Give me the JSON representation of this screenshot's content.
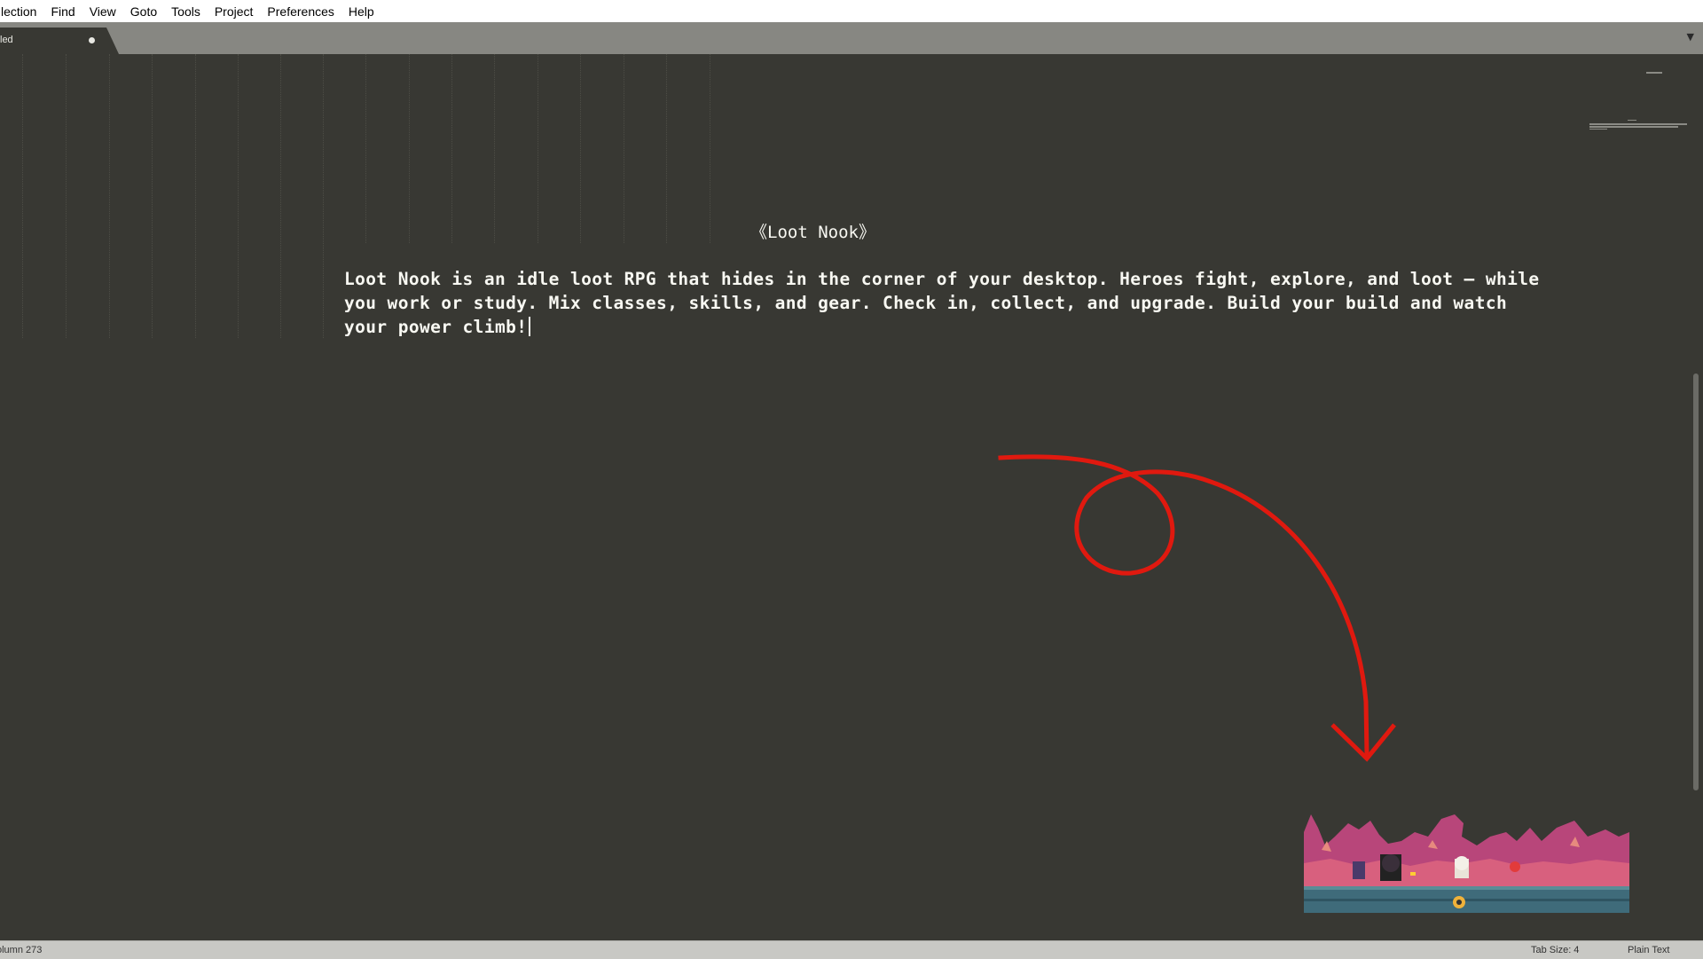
{
  "menu": [
    "lection",
    "Find",
    "View",
    "Goto",
    "Tools",
    "Project",
    "Preferences",
    "Help"
  ],
  "tab": {
    "label": "led",
    "modified": true
  },
  "editor": {
    "title": "《Loot Nook》",
    "body": "Loot Nook is an idle loot RPG that hides in the corner of your desktop. Heroes fight, explore, and loot — while you work or study. Mix classes, skills, and gear. Check in, collect, and upgrade. Build your build and watch your power climb!"
  },
  "annotation": {
    "color": "#e0190f",
    "shape": "looping arrow pointing to game preview"
  },
  "preview": {
    "description_icon": "pixel-art-game-scene"
  },
  "status": {
    "position": "olumn 273",
    "tab_size": "Tab Size: 4",
    "syntax": "Plain Text"
  },
  "colors": {
    "editor_bg": "#383833",
    "text": "#f8f8f2",
    "tabbar": "#878782"
  }
}
